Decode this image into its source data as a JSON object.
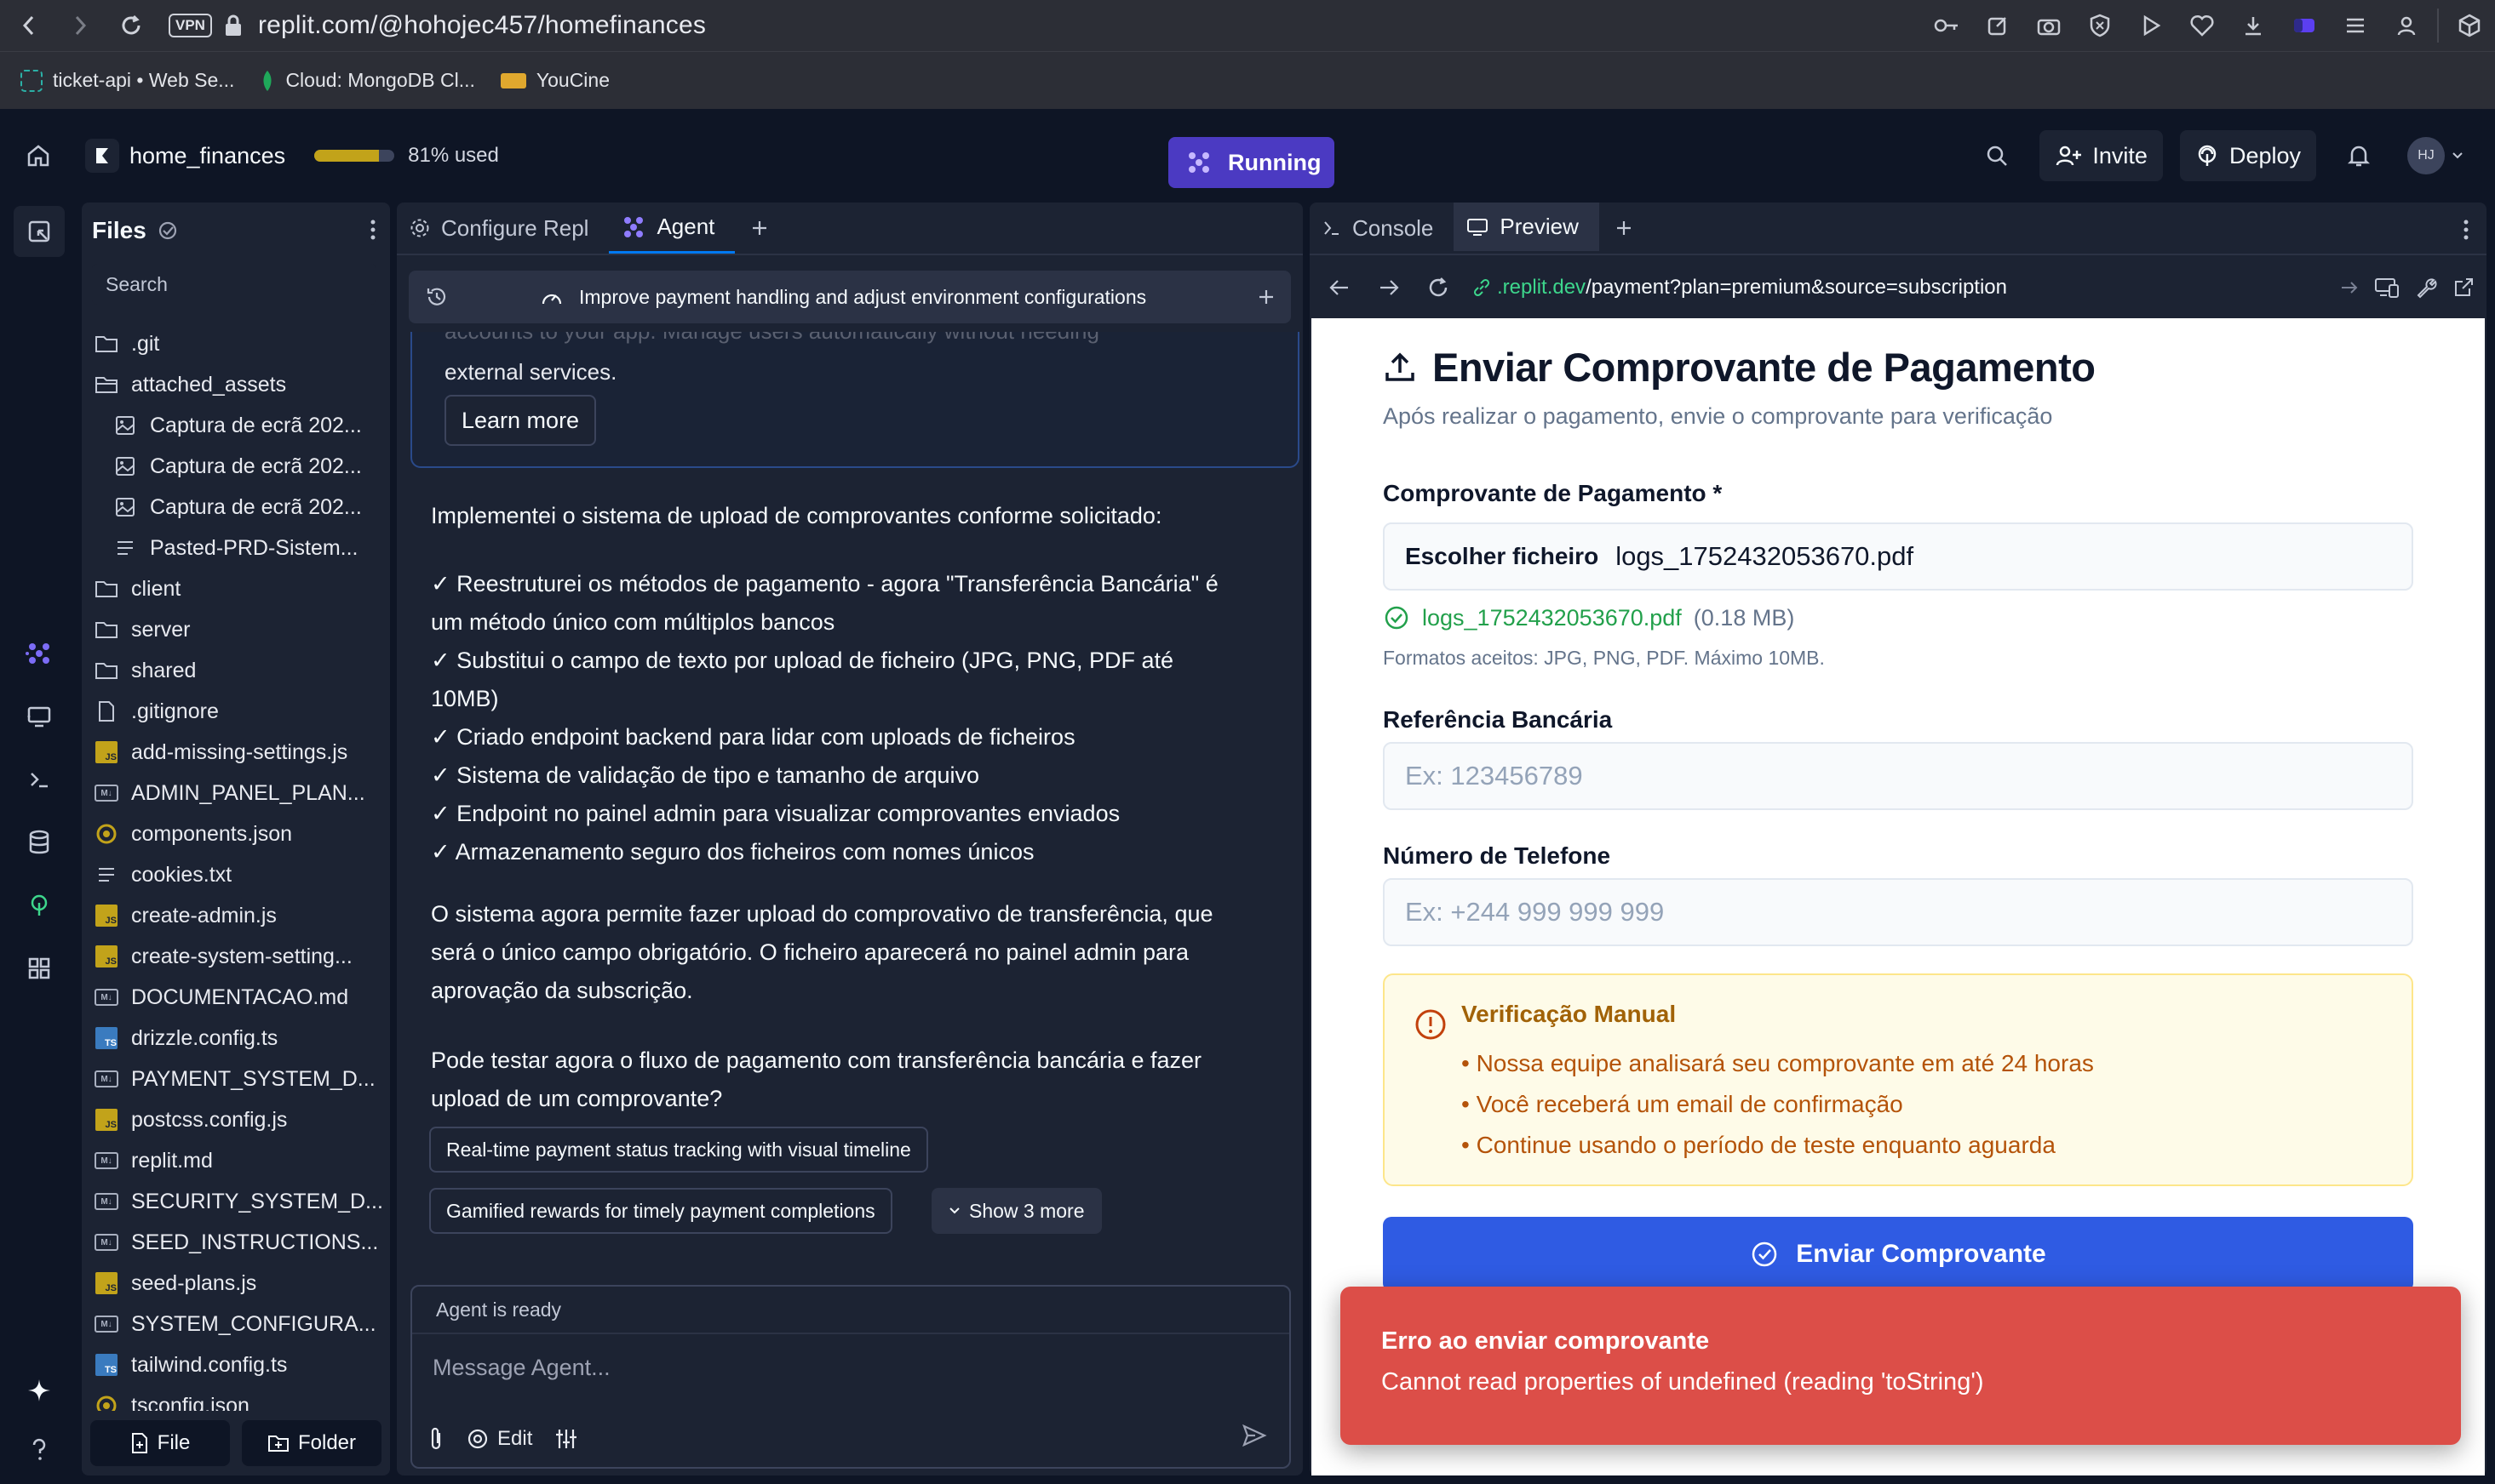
{
  "browser": {
    "url_host": "replit.com/@hohojec457/homefinances",
    "vpn_label": "VPN",
    "bookmarks": [
      {
        "label": "ticket-api • Web Se...",
        "icon": "replit-bookmark-icon",
        "color": "#2bb0a6"
      },
      {
        "label": "Cloud: MongoDB Cl...",
        "icon": "mongodb-leaf-icon",
        "color": "#1fa85a"
      },
      {
        "label": "YouCine",
        "icon": "youcine-icon",
        "color": "#e0a82e"
      }
    ]
  },
  "header": {
    "repl_name": "home_finances",
    "usage_percent": 81,
    "usage_label": "81% used",
    "run_label": "Running",
    "invite_label": "Invite",
    "deploy_label": "Deploy",
    "avatar_initials": "HJ"
  },
  "files": {
    "title": "Files",
    "search_placeholder": "Search",
    "items": [
      {
        "name": ".git",
        "type": "folder",
        "level": 0
      },
      {
        "name": "attached_assets",
        "type": "folder-open",
        "level": 0
      },
      {
        "name": "Captura de ecrã 202...",
        "type": "image",
        "level": 1
      },
      {
        "name": "Captura de ecrã 202...",
        "type": "image",
        "level": 1
      },
      {
        "name": "Captura de ecrã 202...",
        "type": "image",
        "level": 1
      },
      {
        "name": "Pasted-PRD-Sistem...",
        "type": "text",
        "level": 1
      },
      {
        "name": "client",
        "type": "folder",
        "level": 0
      },
      {
        "name": "server",
        "type": "folder",
        "level": 0
      },
      {
        "name": "shared",
        "type": "folder",
        "level": 0
      },
      {
        "name": ".gitignore",
        "type": "file",
        "level": 0
      },
      {
        "name": "add-missing-settings.js",
        "type": "js",
        "level": 0
      },
      {
        "name": "ADMIN_PANEL_PLAN...",
        "type": "md",
        "level": 0
      },
      {
        "name": "components.json",
        "type": "json",
        "level": 0
      },
      {
        "name": "cookies.txt",
        "type": "text",
        "level": 0
      },
      {
        "name": "create-admin.js",
        "type": "js",
        "level": 0
      },
      {
        "name": "create-system-setting...",
        "type": "js",
        "level": 0
      },
      {
        "name": "DOCUMENTACAO.md",
        "type": "md",
        "level": 0
      },
      {
        "name": "drizzle.config.ts",
        "type": "ts",
        "level": 0
      },
      {
        "name": "PAYMENT_SYSTEM_D...",
        "type": "md",
        "level": 0
      },
      {
        "name": "postcss.config.js",
        "type": "js",
        "level": 0
      },
      {
        "name": "replit.md",
        "type": "md",
        "level": 0
      },
      {
        "name": "SECURITY_SYSTEM_D...",
        "type": "md",
        "level": 0
      },
      {
        "name": "SEED_INSTRUCTIONS...",
        "type": "md",
        "level": 0
      },
      {
        "name": "seed-plans.js",
        "type": "js",
        "level": 0
      },
      {
        "name": "SYSTEM_CONFIGURA...",
        "type": "md",
        "level": 0
      },
      {
        "name": "tailwind.config.ts",
        "type": "ts",
        "level": 0
      },
      {
        "name": "tsconfig.json",
        "type": "json",
        "level": 0
      }
    ],
    "footer": {
      "file_label": "File",
      "folder_label": "Folder"
    }
  },
  "agent": {
    "tabs": [
      {
        "label": "Configure Repl",
        "icon": "gear-icon"
      },
      {
        "label": "Agent",
        "icon": "agent-icon"
      }
    ],
    "topic": "Improve payment handling and adjust environment configurations",
    "prev_card": {
      "ghost": "accounts to your app. Manage users automatically without needing",
      "text": "external services.",
      "learn_more": "Learn more"
    },
    "intro": "Implementei o sistema de upload de comprovantes conforme solicitado:",
    "checklist": [
      "✓ Reestruturei os métodos de pagamento - agora \"Transferência Bancária\" é",
      "um método único com múltiplos bancos",
      "✓ Substitui o campo de texto por upload de ficheiro (JPG, PNG, PDF até",
      "10MB)",
      "✓ Criado endpoint backend para lidar com uploads de ficheiros",
      "✓ Sistema de validação de tipo e tamanho de arquivo",
      "✓ Endpoint no painel admin para visualizar comprovantes enviados",
      "✓ Armazenamento seguro dos ficheiros com nomes únicos"
    ],
    "paragraph1": [
      "O sistema agora permite fazer upload do comprovativo de transferência, que",
      "será o único campo obrigatório. O ficheiro aparecerá no painel admin para",
      "aprovação da subscrição."
    ],
    "paragraph2": [
      "Pode testar agora o fluxo de pagamento com transferência bancária e fazer",
      "upload de um comprovante?"
    ],
    "suggestions": [
      "Real-time payment status tracking with visual timeline",
      "Gamified rewards for timely payment completions"
    ],
    "show_more": "Show 3 more",
    "status": "Agent is ready",
    "input_placeholder": "Message Agent...",
    "edit_label": "Edit"
  },
  "preview": {
    "tabs": [
      {
        "label": "Console",
        "icon": "console-icon"
      },
      {
        "label": "Preview",
        "icon": "monitor-icon"
      }
    ],
    "url_host": ".replit.dev",
    "url_path": "/payment?plan=premium&source=subscription"
  },
  "page": {
    "title": "Enviar Comprovante de Pagamento",
    "subtitle": "Após realizar o pagamento, envie o comprovante para verificação",
    "receipt_label": "Comprovante de Pagamento *",
    "choose_file": "Escolher ficheiro",
    "chosen_file": "logs_1752432053670.pdf",
    "uploaded_name": "logs_1752432053670.pdf",
    "uploaded_size": "(0.18 MB)",
    "formats": "Formatos aceitos: JPG, PNG, PDF. Máximo 10MB.",
    "bank_ref_label": "Referência Bancária",
    "bank_ref_placeholder": "Ex: 123456789",
    "phone_label": "Número de Telefone",
    "phone_placeholder": "Ex: +244 999 999 999",
    "notice_title": "Verificação Manual",
    "notice_items": [
      "• Nossa equipe analisará seu comprovante em até 24 horas",
      "• Você receberá um email de confirmação",
      "• Continue usando o período de teste enquanto aguarda"
    ],
    "submit_label": "Enviar Comprovante"
  },
  "toast": {
    "title": "Erro ao enviar comprovante",
    "message": "Cannot read properties of undefined (reading 'toString')"
  }
}
